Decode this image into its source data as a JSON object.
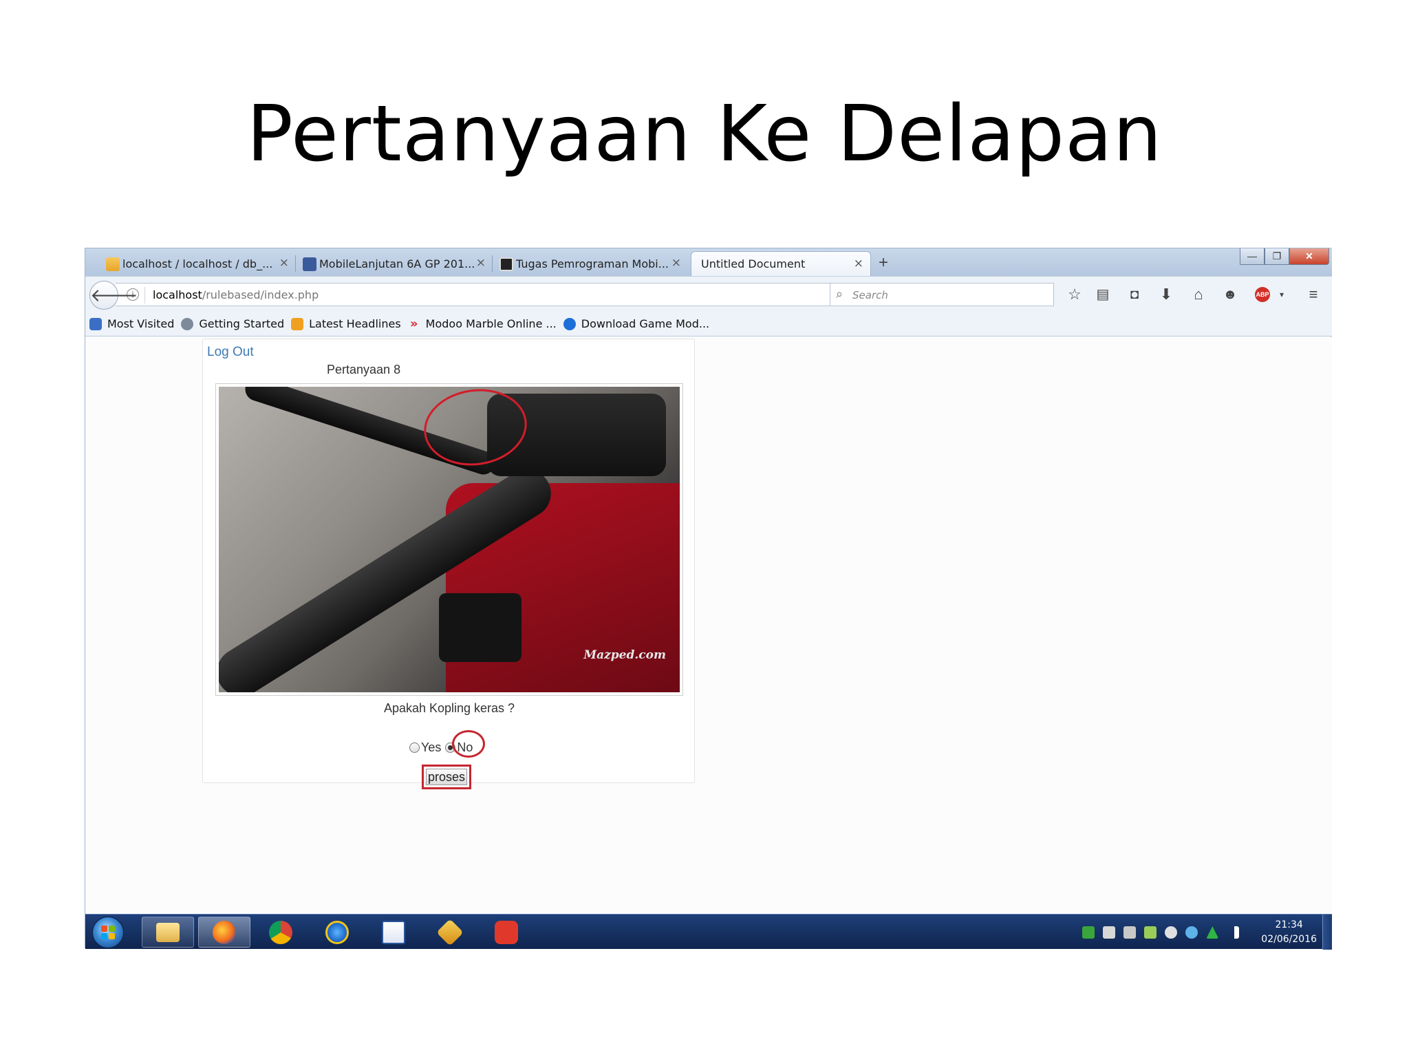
{
  "slide": {
    "title": "Pertanyaan Ke Delapan"
  },
  "browser": {
    "tabs": [
      {
        "label": "localhost / localhost / db_...",
        "icon": "phpmyadmin-icon",
        "active": false
      },
      {
        "label": "MobileLanjutan 6A GP 201...",
        "icon": "user-page-icon",
        "active": false
      },
      {
        "label": "Tugas Pemrograman Mobi...",
        "icon": "document-icon",
        "active": false
      },
      {
        "label": "Untitled Document",
        "active": true
      }
    ],
    "new_tab": "+",
    "url_host": "localhost",
    "url_path": "/rulebased/index.php",
    "search_placeholder": "Search",
    "bookmarks": [
      {
        "label": "Most Visited",
        "icon": "most-visited-icon",
        "color": "#3b6fc6"
      },
      {
        "label": "Getting Started",
        "icon": "globe-icon",
        "color": "#7d8a99"
      },
      {
        "label": "Latest Headlines",
        "icon": "rss-icon",
        "color": "#f0a020"
      },
      {
        "label": "Modoo Marble Online ...",
        "icon": "chevron-icon",
        "color": "#d6262e"
      },
      {
        "label": "Download Game Mod...",
        "icon": "firefox-icon",
        "color": "#1d6fd8"
      }
    ]
  },
  "page": {
    "logout": "Log Out",
    "question_title": "Pertanyaan 8",
    "image_watermark": "Mazped.com",
    "question_text": "Apakah Kopling keras ?",
    "answer_yes": "Yes",
    "answer_no": "No",
    "selected": "No",
    "submit_label": "proses"
  },
  "taskbar": {
    "apps": [
      {
        "name": "explorer",
        "icon": "folder-icon"
      },
      {
        "name": "firefox",
        "icon": "firefox-icon",
        "active": true
      },
      {
        "name": "chrome",
        "icon": "chrome-icon"
      },
      {
        "name": "ie",
        "icon": "internet-explorer-icon"
      },
      {
        "name": "word",
        "icon": "word-icon"
      },
      {
        "name": "winamp",
        "icon": "lightning-icon"
      },
      {
        "name": "app",
        "icon": "paw-icon"
      }
    ],
    "time": "21:34",
    "date": "02/06/2016"
  }
}
